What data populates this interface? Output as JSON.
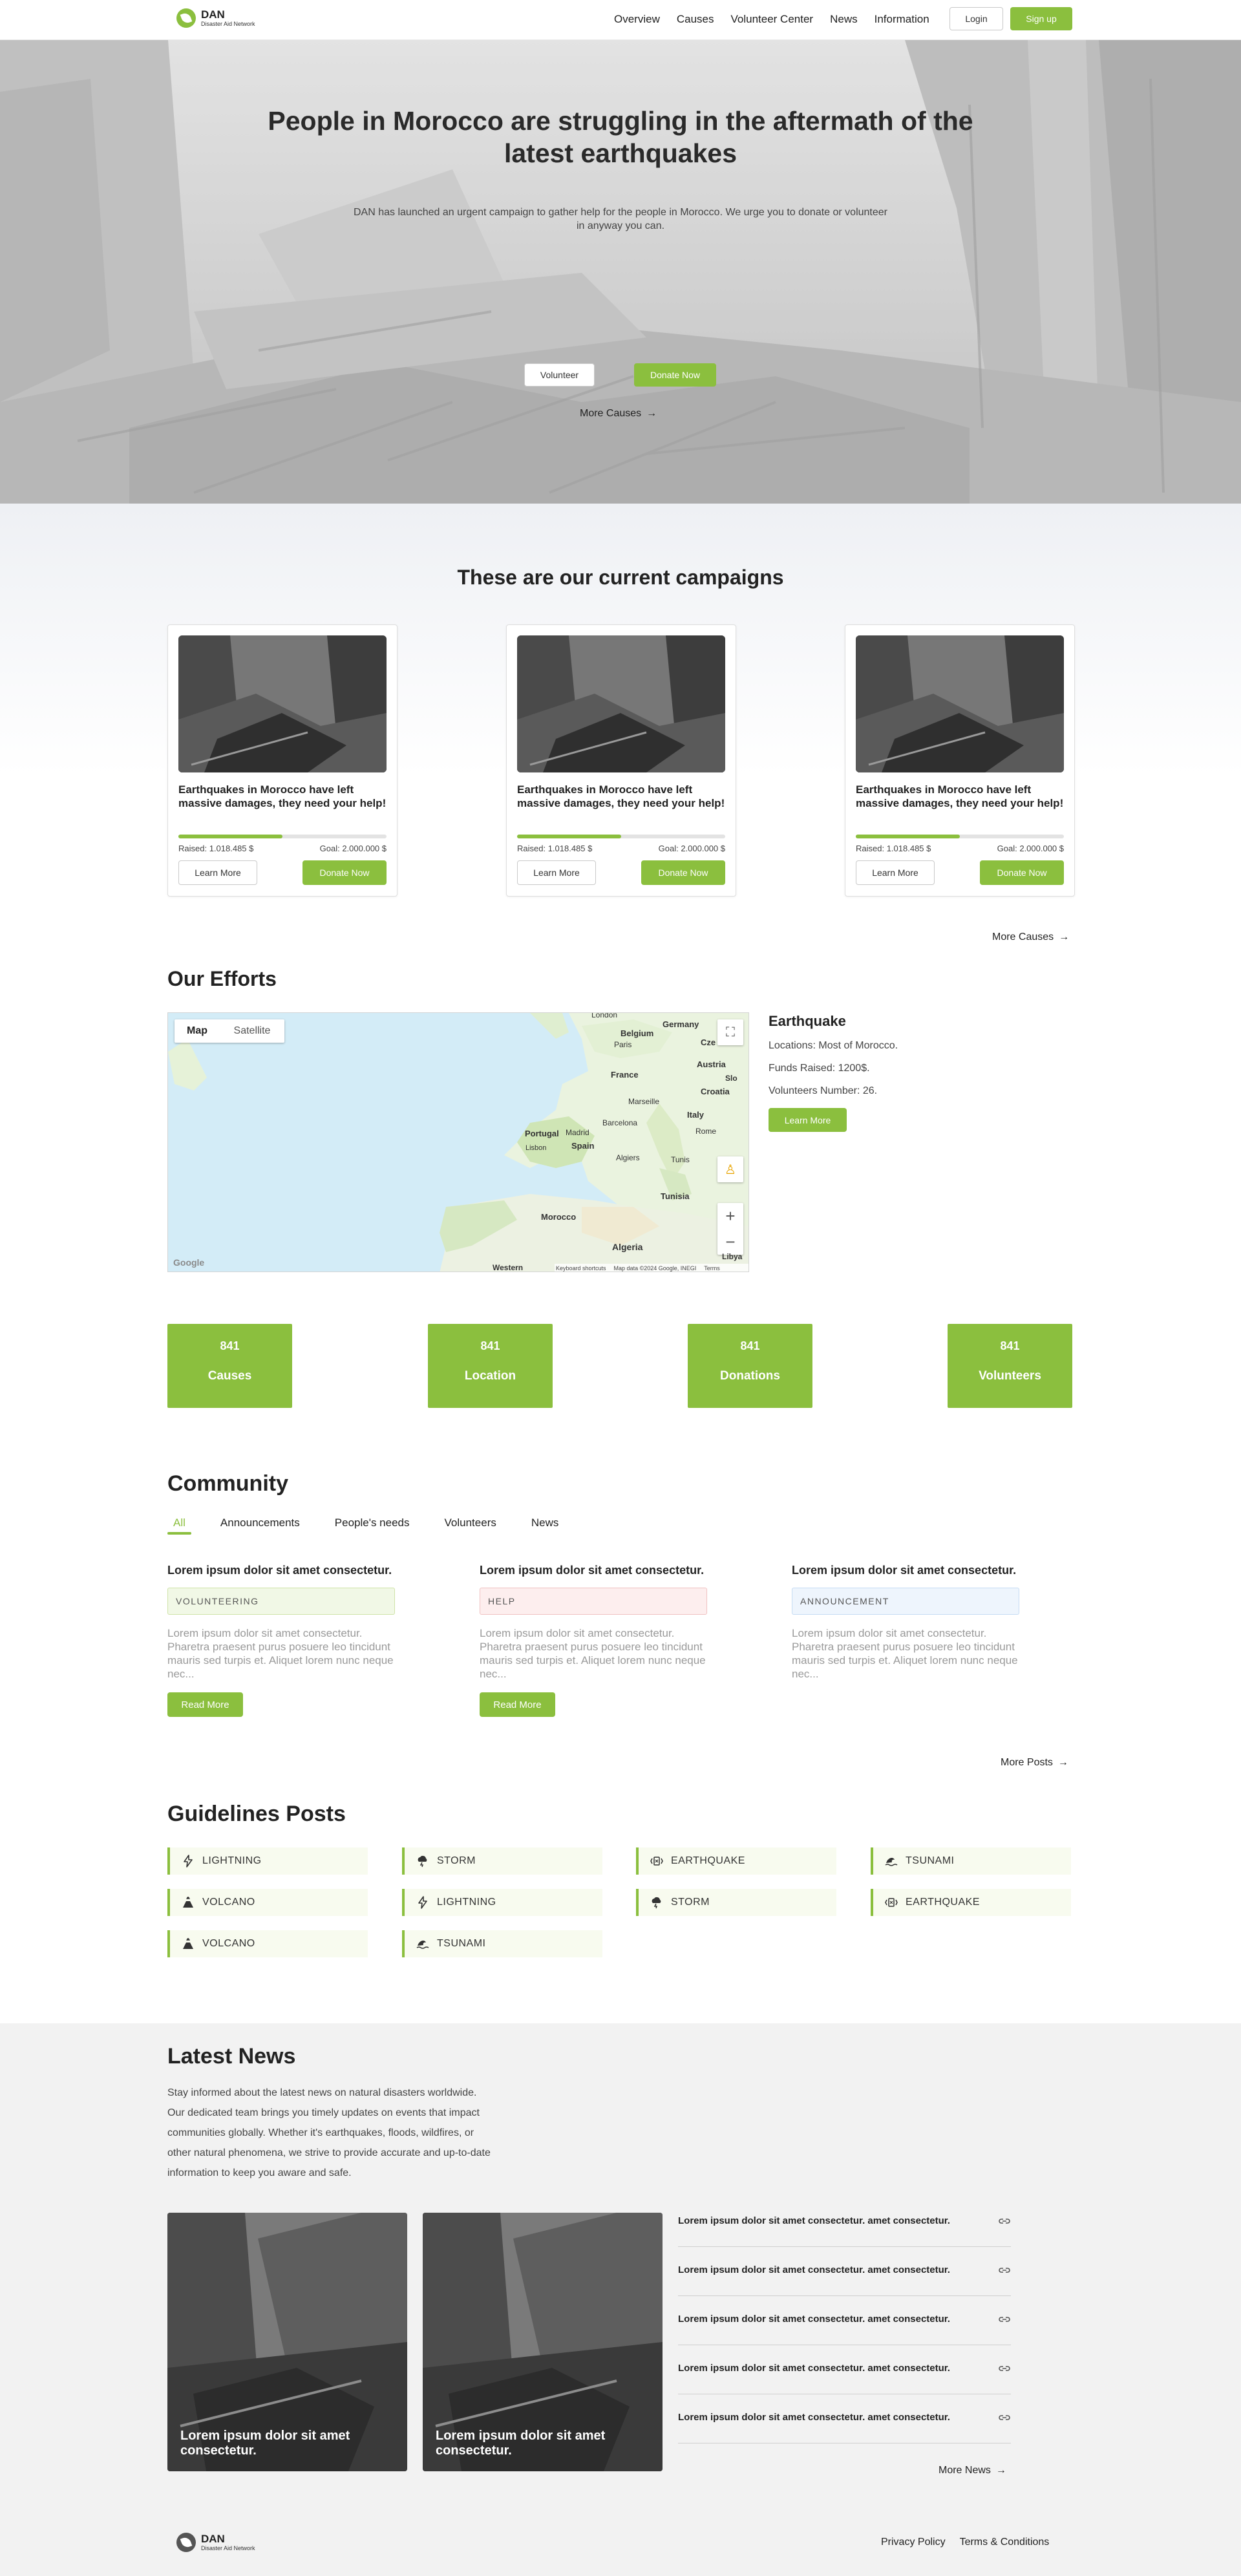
{
  "header": {
    "logo_title": "DAN",
    "logo_subtitle": "Disaster Aid Network",
    "nav": [
      "Overview",
      "Causes",
      "Volunteer Center",
      "News",
      "Information"
    ],
    "login": "Login",
    "signup": "Sign up"
  },
  "hero": {
    "title": "People in Morocco are struggling in the aftermath of the latest earthquakes",
    "text": "DAN has launched an urgent campaign to gather help for the people in Morocco. We urge you to donate or volunteer in anyway you can.",
    "volunteer": "Volunteer",
    "donate": "Donate Now",
    "more": "More Causes"
  },
  "campaigns": {
    "title": "These are our current campaigns",
    "cards": [
      {
        "title": "Earthquakes in Morocco have left massive damages, they need your help!",
        "raised": "Raised: 1.018.485 $",
        "goal": "Goal: 2.000.000 $",
        "progress": 0.5,
        "learn": "Learn More",
        "donate": "Donate Now"
      },
      {
        "title": "Earthquakes in Morocco have left massive damages, they need your help!",
        "raised": "Raised: 1.018.485 $",
        "goal": "Goal: 2.000.000 $",
        "progress": 0.5,
        "learn": "Learn More",
        "donate": "Donate Now"
      },
      {
        "title": "Earthquakes in Morocco have left massive damages, they need your help!",
        "raised": "Raised: 1.018.485 $",
        "goal": "Goal: 2.000.000 $",
        "progress": 0.5,
        "learn": "Learn More",
        "donate": "Donate Now"
      }
    ],
    "more": "More Causes"
  },
  "efforts": {
    "title": "Our Efforts",
    "map": {
      "tab_map": "Map",
      "tab_satellite": "Satellite",
      "labels": [
        "London",
        "Belgium",
        "Germany",
        "Paris",
        "Cze",
        "Austria",
        "France",
        "Slo",
        "Croatia",
        "Marseille",
        "Italy",
        "Barcelona",
        "Rome",
        "Portugal",
        "Madrid",
        "Spain",
        "Lisbon",
        "Algiers",
        "Tunis",
        "Tunisia",
        "Morocco",
        "Algeria",
        "Libya",
        "Western"
      ],
      "footer": [
        "Keyboard shortcuts",
        "Map data ©2024 Google, INEGI",
        "Terms"
      ],
      "brand": "Google"
    },
    "info_title": "Earthquake",
    "info_lines": [
      "Locations: Most of Morocco.",
      "Funds Raised: 1200$.",
      "Volunteers Number: 26."
    ],
    "learn": "Learn More"
  },
  "stats": [
    {
      "value": "841",
      "label": "Causes"
    },
    {
      "value": "841",
      "label": "Location"
    },
    {
      "value": "841",
      "label": "Donations"
    },
    {
      "value": "841",
      "label": "Volunteers"
    }
  ],
  "community": {
    "title": "Community",
    "tabs": [
      "All",
      "Announcements",
      "People's needs",
      "Volunteers",
      "News"
    ],
    "posts": [
      {
        "title": "Lorem ipsum dolor sit amet consectetur.",
        "tag": "VOLUNTEERING",
        "text": "Lorem ipsum dolor sit amet consectetur. Pharetra praesent purus posuere leo tincidunt mauris sed turpis et. Aliquet lorem nunc neque nec...",
        "read": "Read More",
        "tag_color": "#f1f8e6",
        "tag_border": "#cfe3a8"
      },
      {
        "title": "Lorem ipsum dolor sit amet consectetur.",
        "tag": "HELP",
        "text": "Lorem ipsum dolor sit amet consectetur. Pharetra praesent purus posuere leo tincidunt mauris sed turpis et. Aliquet lorem nunc neque nec...",
        "read": "Read More",
        "tag_color": "#fdeeee",
        "tag_border": "#f0c2c2"
      },
      {
        "title": "Lorem ipsum dolor sit amet consectetur.",
        "tag": "ANNOUNCEMENT",
        "text": "Lorem ipsum dolor sit amet consectetur. Pharetra praesent purus posuere leo tincidunt mauris sed turpis et. Aliquet lorem nunc neque nec...",
        "read": "",
        "tag_color": "#eef5fd",
        "tag_border": "#c6dcf3"
      }
    ],
    "more": "More Posts"
  },
  "guidelines": {
    "title": "Guidelines Posts",
    "items": [
      {
        "label": "LIGHTNING",
        "icon": "lightning-icon"
      },
      {
        "label": "STORM",
        "icon": "storm-icon"
      },
      {
        "label": "EARTHQUAKE",
        "icon": "earthquake-icon"
      },
      {
        "label": "TSUNAMI",
        "icon": "tsunami-icon"
      },
      {
        "label": "VOLCANO",
        "icon": "volcano-icon"
      },
      {
        "label": "LIGHTNING",
        "icon": "lightning-icon"
      },
      {
        "label": "STORM",
        "icon": "storm-icon"
      },
      {
        "label": "EARTHQUAKE",
        "icon": "earthquake-icon"
      },
      {
        "label": "VOLCANO",
        "icon": "volcano-icon"
      },
      {
        "label": "TSUNAMI",
        "icon": "tsunami-icon"
      }
    ]
  },
  "news": {
    "title": "Latest News",
    "intro": "Stay informed about the latest news on natural disasters worldwide. Our dedicated team brings you timely updates on events that impact communities globally. Whether it's earthquakes, floods, wildfires, or other natural phenomena, we strive to provide accurate and up-to-date information to keep you aware and safe.",
    "cards": [
      "Lorem ipsum dolor sit amet consectetur.",
      "Lorem ipsum dolor sit amet consectetur."
    ],
    "items": [
      "Lorem ipsum dolor sit amet consectetur. amet consectetur.",
      "Lorem ipsum dolor sit amet consectetur. amet consectetur.",
      "Lorem ipsum dolor sit amet consectetur. amet consectetur.",
      "Lorem ipsum dolor sit amet consectetur. amet consectetur.",
      "Lorem ipsum dolor sit amet consectetur. amet consectetur."
    ],
    "more": "More News"
  },
  "footer": {
    "logo_title": "DAN",
    "logo_subtitle": "Disaster Aid Network",
    "links": [
      "Privacy Policy",
      "Terms & Conditions"
    ]
  },
  "colors": {
    "accent": "#8bbf3e",
    "text": "#222222",
    "muted": "#9a9a9a"
  }
}
